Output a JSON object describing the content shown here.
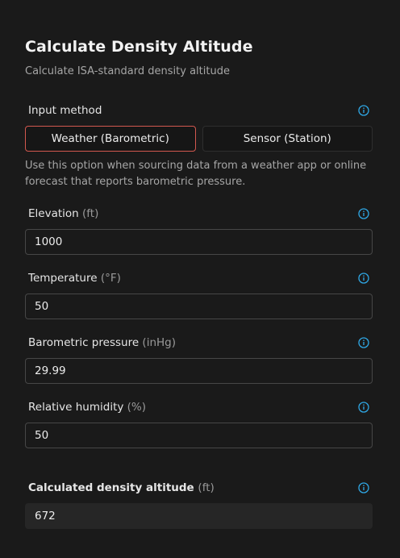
{
  "header": {
    "title": "Calculate Density Altitude",
    "subtitle": "Calculate ISA-standard density altitude"
  },
  "input_method": {
    "label": "Input method",
    "options": [
      "Weather (Barometric)",
      "Sensor (Station)"
    ],
    "selected": "Weather (Barometric)",
    "help": "Use this option when sourcing data from a weather app or online forecast that reports barometric pressure."
  },
  "fields": {
    "elevation": {
      "label": "Elevation",
      "unit": "(ft)",
      "value": "1000"
    },
    "temperature": {
      "label": "Temperature",
      "unit": "(°F)",
      "value": "50"
    },
    "pressure": {
      "label": "Barometric pressure",
      "unit": "(inHg)",
      "value": "29.99"
    },
    "humidity": {
      "label": "Relative humidity",
      "unit": "(%)",
      "value": "50"
    }
  },
  "result": {
    "label": "Calculated density altitude",
    "unit": "(ft)",
    "value": "672"
  },
  "colors": {
    "background": "#1a1a1a",
    "accent_border": "#d2584f",
    "info_icon": "#2fa8e6"
  },
  "icons": {
    "info": "info-circle-icon"
  }
}
